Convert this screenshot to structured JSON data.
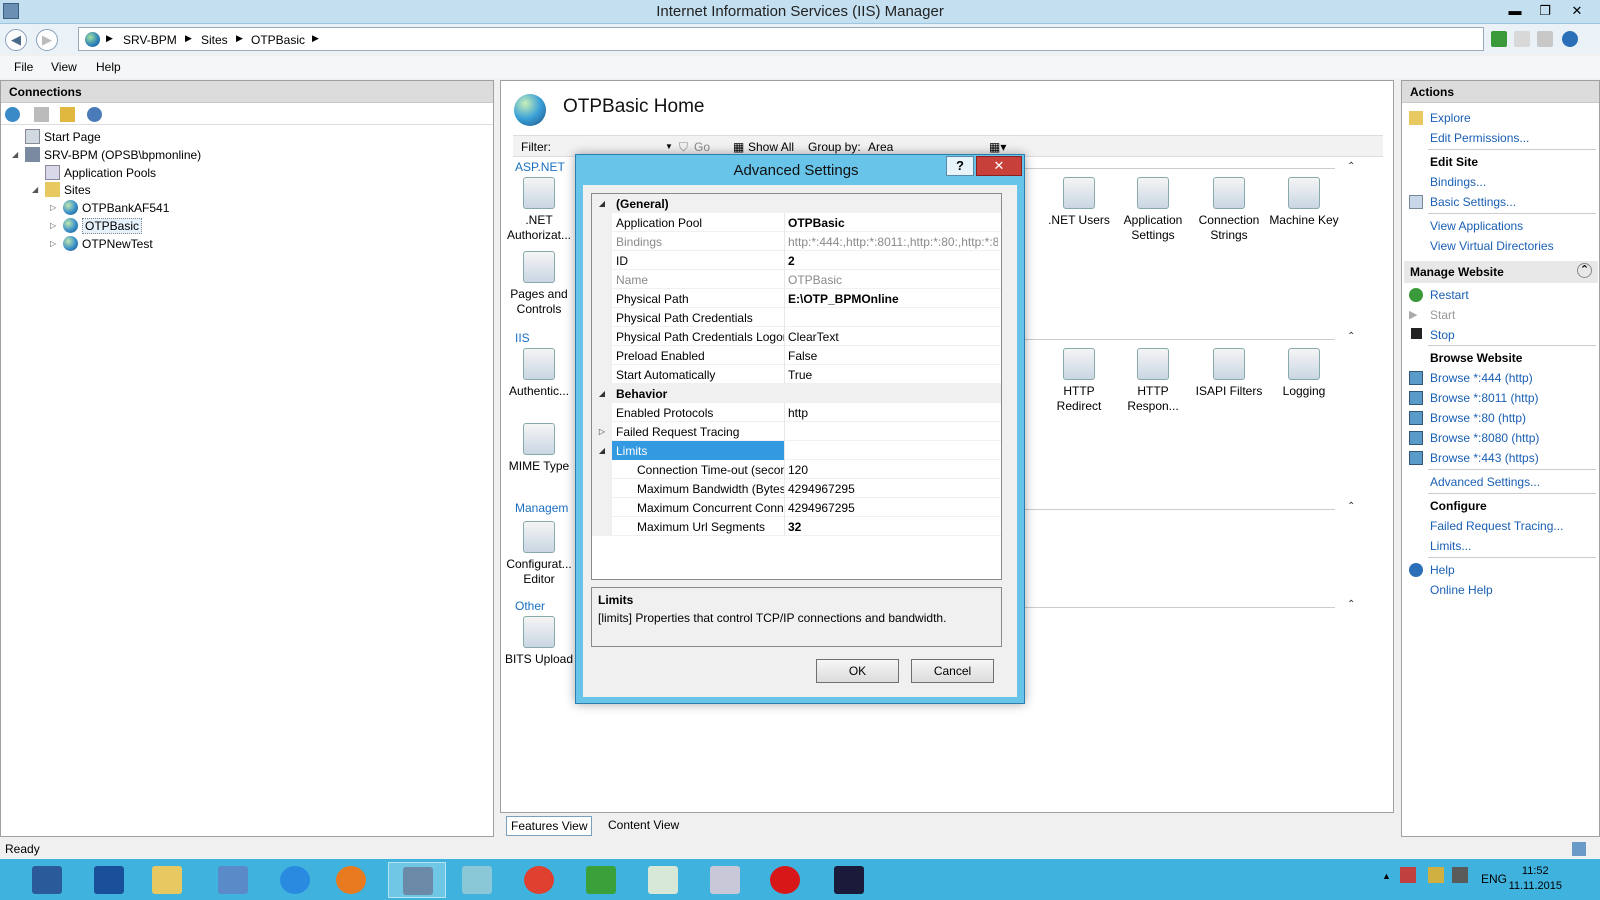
{
  "window": {
    "title": "Internet Information Services (IIS) Manager",
    "min": "▬",
    "max": "❐",
    "close": "✕"
  },
  "address": {
    "crumbs": [
      "SRV-BPM",
      "Sites",
      "OTPBasic"
    ]
  },
  "menu": [
    "File",
    "View",
    "Help"
  ],
  "connections": {
    "header": "Connections",
    "tree": [
      {
        "label": "Start Page"
      },
      {
        "label": "SRV-BPM (OPSB\\bpmonline)"
      },
      {
        "label": "Application Pools"
      },
      {
        "label": "Sites"
      },
      {
        "label": "OTPBankAF541"
      },
      {
        "label": "OTPBasic"
      },
      {
        "label": "OTPNewTest"
      }
    ]
  },
  "center": {
    "title": "OTPBasic Home",
    "filter": {
      "label": "Filter:",
      "go": "Go",
      "show_all": "Show All",
      "group_by": "Group by:",
      "group_value": "Area"
    },
    "sections": [
      "ASP.NET",
      "IIS",
      "Managem",
      "Other"
    ],
    "features": [
      {
        "label": ".NET Authorizat..."
      },
      {
        "label": "Pages and Controls"
      },
      {
        "label": "Authentic..."
      },
      {
        "label": "MIME Type"
      },
      {
        "label": "Configurat... Editor"
      },
      {
        "label": "BITS Upload"
      },
      {
        "label": ".NET Users"
      },
      {
        "label": "Application Settings"
      },
      {
        "label": "Connection Strings"
      },
      {
        "label": "Machine Key"
      },
      {
        "label": "HTTP Redirect"
      },
      {
        "label": "HTTP Respon..."
      },
      {
        "label": "ISAPI Filters"
      },
      {
        "label": "Logging"
      }
    ],
    "tabs": [
      "Features View",
      "Content View"
    ]
  },
  "actions": {
    "header": "Actions",
    "explore": "Explore",
    "edit_permissions": "Edit Permissions...",
    "edit_site": "Edit Site",
    "bindings": "Bindings...",
    "basic_settings": "Basic Settings...",
    "view_applications": "View Applications",
    "view_virtual_dirs": "View Virtual Directories",
    "manage_website": "Manage Website",
    "restart": "Restart",
    "start": "Start",
    "stop": "Stop",
    "browse_website": "Browse Website",
    "browse": [
      "Browse *:444 (http)",
      "Browse *:8011 (http)",
      "Browse *:80 (http)",
      "Browse *:8080 (http)",
      "Browse *:443 (https)"
    ],
    "advanced_settings": "Advanced Settings...",
    "configure": "Configure",
    "failed_request_tracing": "Failed Request Tracing...",
    "limits": "Limits...",
    "help": "Help",
    "online_help": "Online Help"
  },
  "status": "Ready",
  "taskbar": {
    "lang": "ENG",
    "time": "11:52",
    "date": "11.11.2015"
  },
  "dialog": {
    "title": "Advanced Settings",
    "help": "?",
    "close": "✕",
    "rows": [
      {
        "key": "(General)",
        "value": ""
      },
      {
        "key": "Application Pool",
        "value": "OTPBasic"
      },
      {
        "key": "Bindings",
        "value": "http:*:444:,http:*:8011:,http:*:80:,http:*:8"
      },
      {
        "key": "ID",
        "value": "2"
      },
      {
        "key": "Name",
        "value": "OTPBasic"
      },
      {
        "key": "Physical Path",
        "value": "E:\\OTP_BPMOnline"
      },
      {
        "key": "Physical Path Credentials",
        "value": ""
      },
      {
        "key": "Physical Path Credentials Logon",
        "value": "ClearText"
      },
      {
        "key": "Preload Enabled",
        "value": "False"
      },
      {
        "key": "Start Automatically",
        "value": "True"
      },
      {
        "key": "Behavior",
        "value": ""
      },
      {
        "key": "Enabled Protocols",
        "value": "http"
      },
      {
        "key": "Failed Request Tracing",
        "value": ""
      },
      {
        "key": "Limits",
        "value": ""
      },
      {
        "key": "Connection Time-out (seconds)",
        "value": "120"
      },
      {
        "key": "Maximum Bandwidth (Bytes/second)",
        "value": "4294967295"
      },
      {
        "key": "Maximum Concurrent Connections",
        "value": "4294967295"
      },
      {
        "key": "Maximum Url Segments",
        "value": "32"
      }
    ],
    "desc_title": "Limits",
    "desc_text": "[limits] Properties that control TCP/IP connections and bandwidth.",
    "ok": "OK",
    "cancel": "Cancel"
  }
}
